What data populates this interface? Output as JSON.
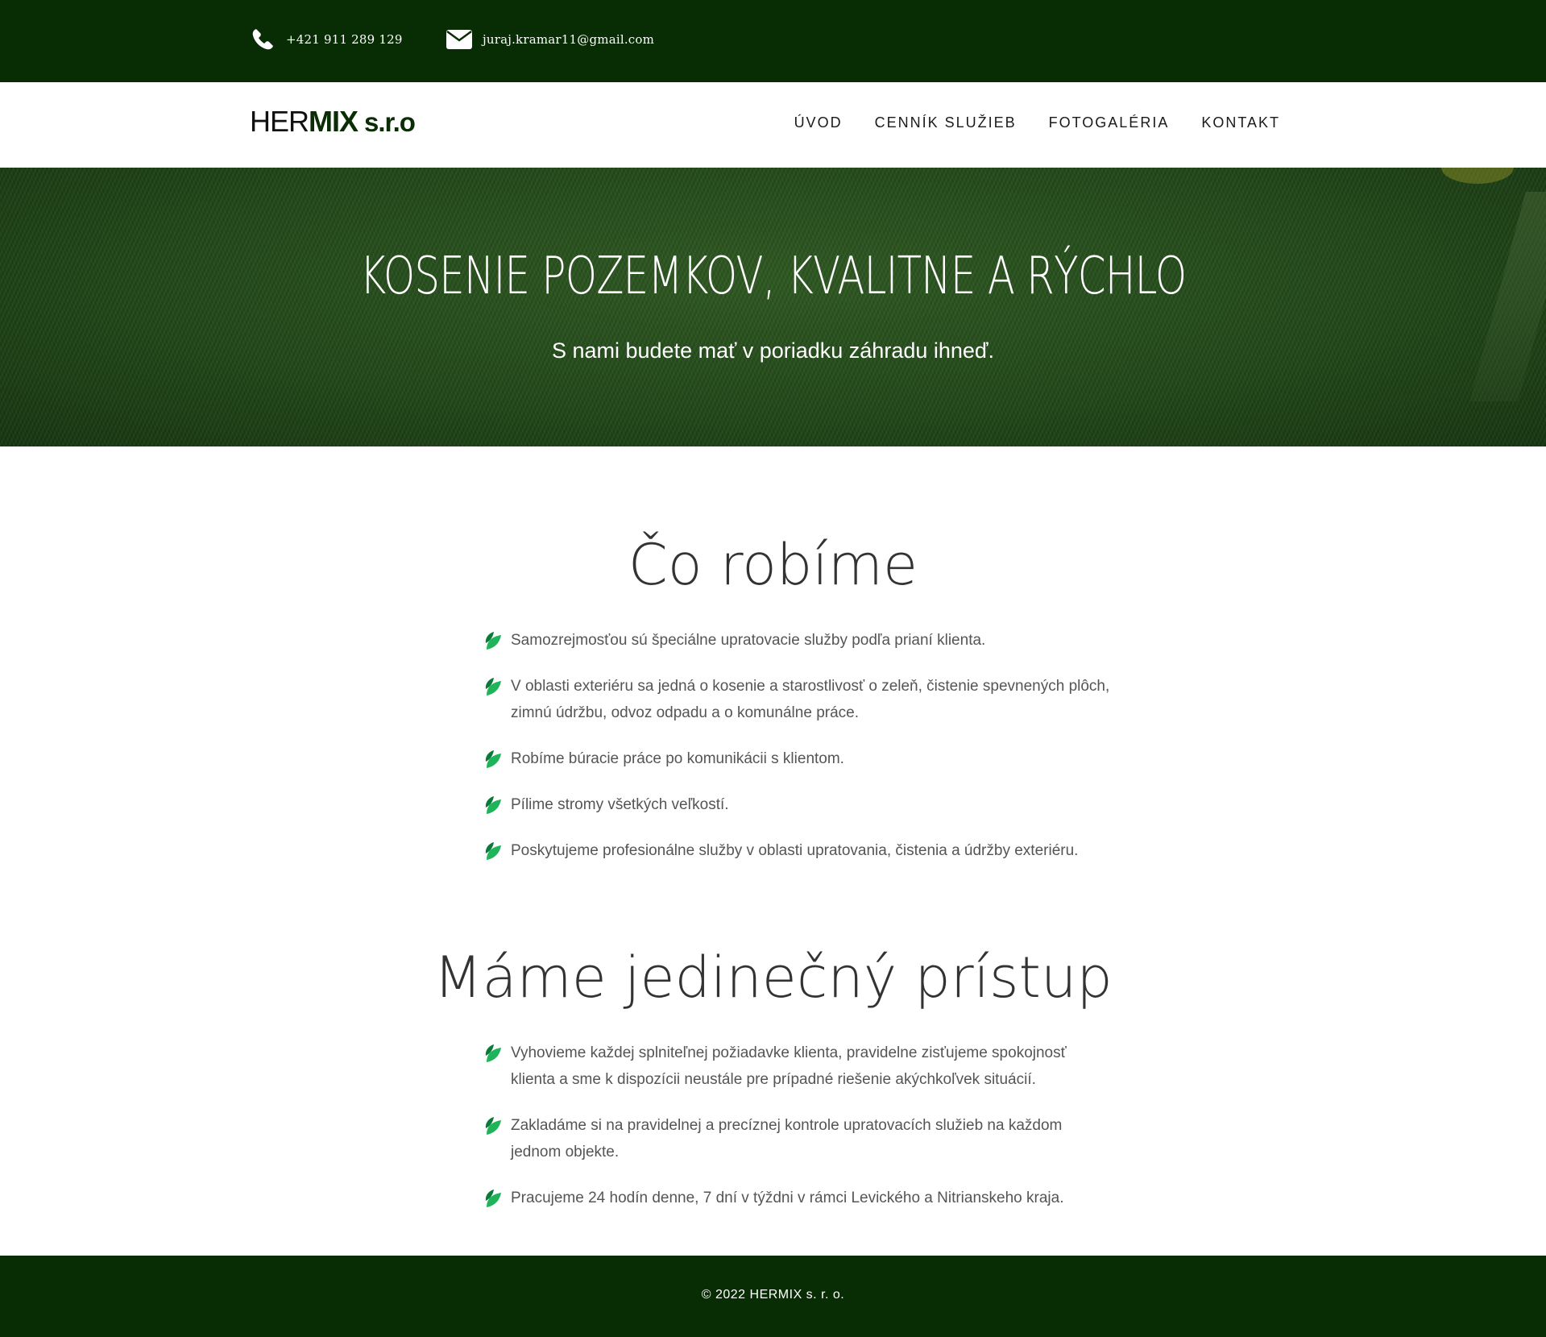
{
  "topbar": {
    "phone_icon": "phone-icon",
    "phone": "+421 911 289 129",
    "mail_icon": "envelope-icon",
    "email": "juraj.kramar11@gmail.com"
  },
  "header": {
    "logo_part1": "HER",
    "logo_part2": "MIX",
    "logo_part3": "s.r.o",
    "nav": [
      "ÚVOD",
      "CENNÍK SLUŽIEB",
      "FOTOGALÉRIA",
      "KONTAKT"
    ]
  },
  "hero": {
    "title": "KOSENIE POZEMKOV, KVALITNE A RÝCHLO",
    "subtitle": "S nami budete mať v poriadku záhradu ihneď."
  },
  "section1": {
    "title": "Čo robíme",
    "items": [
      "Samozrejmosťou sú špeciálne upratovacie služby podľa prianí klienta.",
      "V oblasti exteriéru sa jedná o kosenie a starostlivosť o zeleň, čistenie spevnených plôch, zimnú údržbu, odvoz odpadu a o komunálne práce.",
      "Robíme búracie práce po komunikácii s klientom.",
      "Pílime stromy všetkých veľkostí.",
      "Poskytujeme profesionálne služby v oblasti upratovania, čistenia a údržby exteriéru."
    ]
  },
  "section2": {
    "title": "Máme jedinečný prístup",
    "items": [
      "Vyhovieme každej splniteľnej požiadavke klienta, pravidelne zisťujeme spokojnosť klienta a sme k dispozícii neustále pre prípadné riešenie akýchkoľvek situácií.",
      "Zakladáme si na pravidelnej a precíznej kontrole upratovacích služieb na každom jednom objekte.",
      "Pracujeme 24 hodín denne, 7 dní v týždni v rámci Levického a Nitrianskeho kraja."
    ]
  },
  "footer": {
    "copyright": "© 2022 HERMIX s. r. o."
  },
  "colors": {
    "dark_green": "#082c04",
    "leaf_green": "#1fb35a"
  }
}
